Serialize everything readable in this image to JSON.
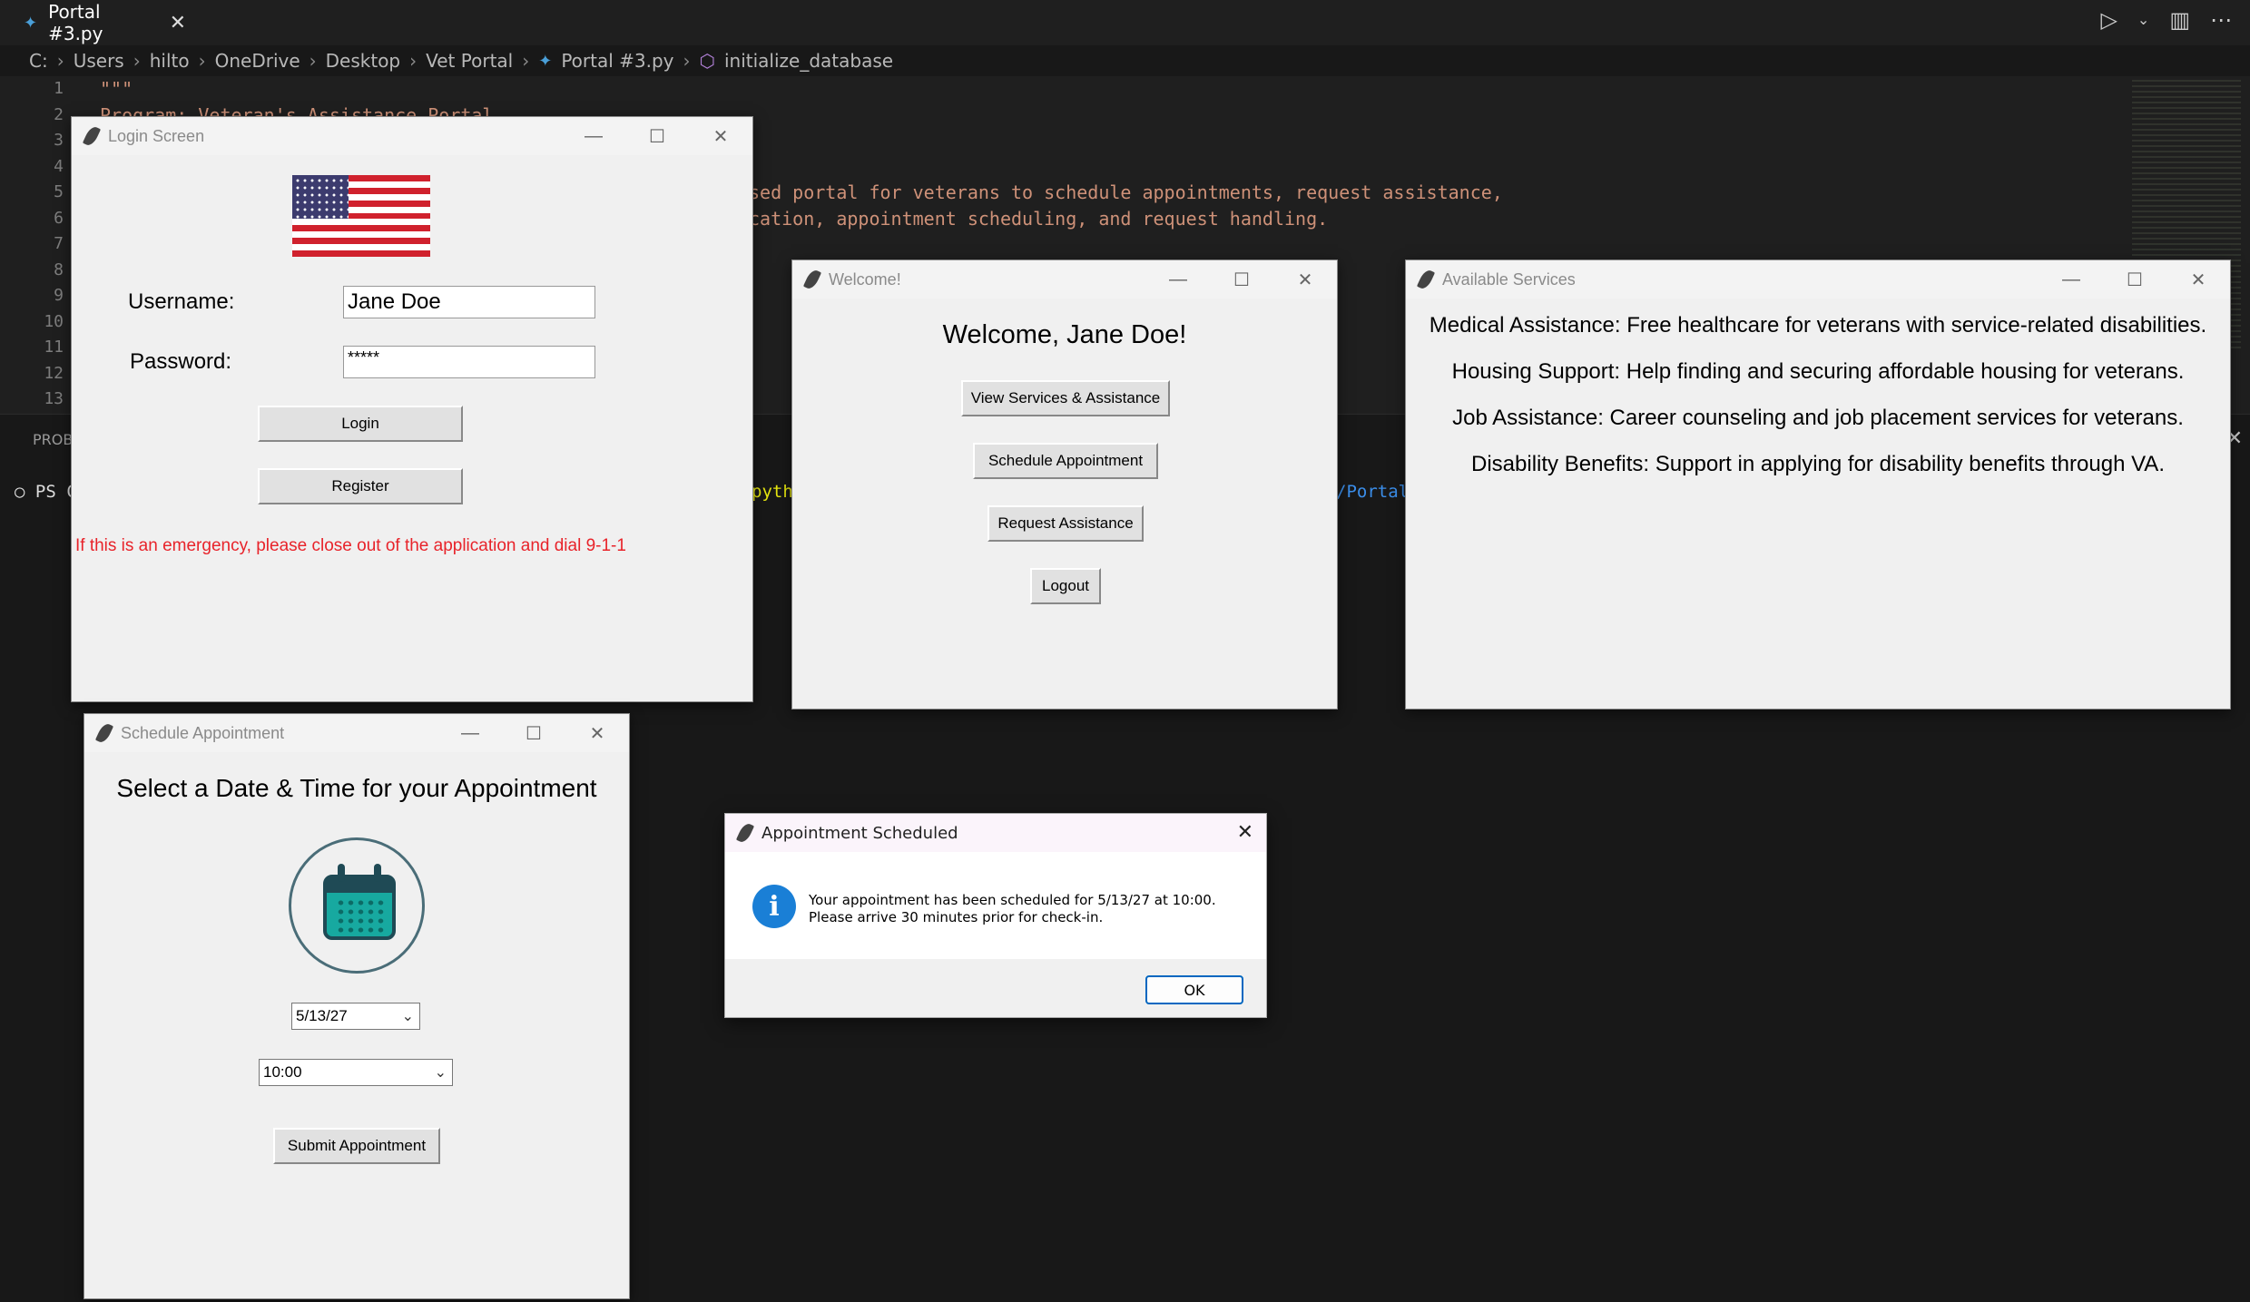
{
  "vscode": {
    "tab_label": "Portal #3.py",
    "breadcrumb": [
      "C:",
      "Users",
      "hilto",
      "OneDrive",
      "Desktop",
      "Vet Portal",
      "Portal #3.py",
      "initialize_database"
    ],
    "line_numbers": [
      "1",
      "2",
      "3",
      "4",
      "5",
      "6",
      "7",
      "8",
      "9",
      "10",
      "11",
      "12",
      "13"
    ],
    "code_lines": [
      "\"\"\"",
      "Program: Veteran's Assistance Portal",
      "",
      "",
      "sed portal for veterans to schedule appointments, request assistance,",
      "cation, appointment scheduling, and request handling.",
      "",
      "",
      "",
      "",
      "",
      "",
      ""
    ],
    "panel_tab": "PROB",
    "terminal_prompt": "PS C",
    "terminal_frag_python": "pyth",
    "terminal_frag_portal": "/Portal"
  },
  "login": {
    "title": "Login Screen",
    "username_label": "Username:",
    "username_value": "Jane Doe",
    "password_label": "Password:",
    "password_value": "*****",
    "login_button": "Login",
    "register_button": "Register",
    "emergency_text": "If this is an emergency, please close out of the application and dial 9-1-1",
    "colors": {
      "emergency": "#e8232a"
    }
  },
  "welcome": {
    "title": "Welcome!",
    "heading": "Welcome, Jane Doe!",
    "buttons": [
      "View Services & Assistance",
      "Schedule Appointment",
      "Request Assistance",
      "Logout"
    ]
  },
  "services": {
    "title": "Available Services",
    "items": [
      "Medical Assistance: Free healthcare for veterans with service-related disabilities.",
      "Housing Support: Help finding and securing affordable housing for veterans.",
      "Job Assistance: Career counseling and job placement services for veterans.",
      "Disability Benefits: Support in applying for disability benefits through VA."
    ]
  },
  "schedule": {
    "title": "Schedule Appointment",
    "heading": "Select a Date & Time for your Appointment",
    "date_value": "5/13/27",
    "time_value": "10:00",
    "submit_button": "Submit Appointment",
    "icon": "calendar-icon"
  },
  "dialog": {
    "title": "Appointment Scheduled",
    "message_line1": "Your appointment has been scheduled for 5/13/27 at 10:00.",
    "message_line2": "Please arrive 30 minutes prior for check-in.",
    "ok_button": "OK",
    "icon": "info-icon"
  }
}
